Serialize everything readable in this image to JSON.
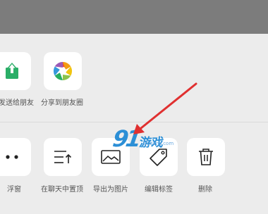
{
  "row1": [
    {
      "label": "发送给朋友",
      "icon": "share-upload-icon",
      "color": "#2aae67"
    },
    {
      "label": "分享到朋友圈",
      "icon": "moments-aperture-icon"
    }
  ],
  "row2": [
    {
      "label": "浮窗",
      "icon": "floating-window-icon"
    },
    {
      "label": "在聊天中置顶",
      "icon": "pin-to-top-icon"
    },
    {
      "label": "导出为图片",
      "icon": "image-icon"
    },
    {
      "label": "编辑标签",
      "icon": "tag-icon"
    },
    {
      "label": "删除",
      "icon": "trash-icon"
    }
  ],
  "watermark": {
    "number": "91",
    "text": "游戏",
    "url": "91danji.com",
    "color": "#2c8fd6"
  },
  "annotation": {
    "color": "#e03030"
  }
}
